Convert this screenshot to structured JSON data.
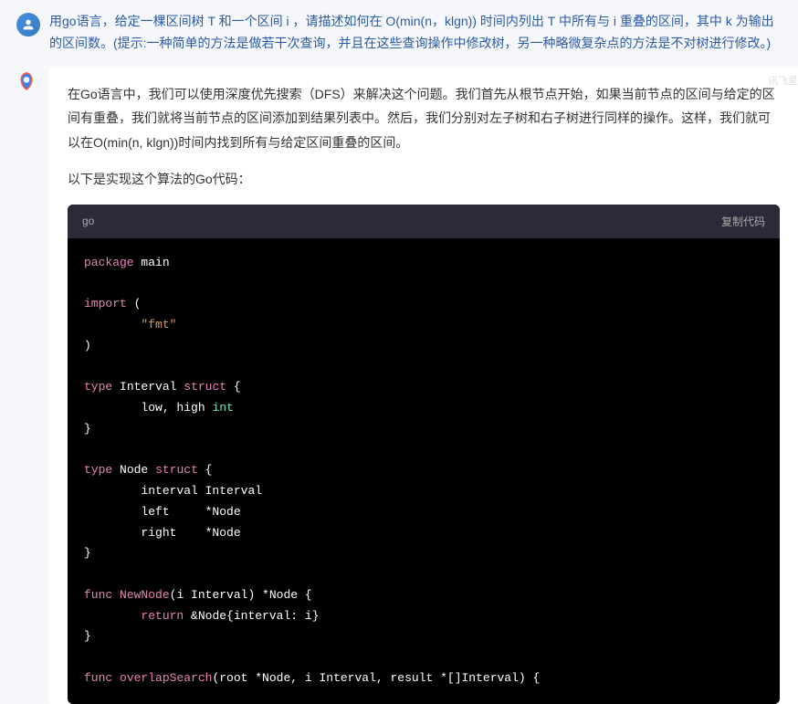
{
  "question": "用go语言，给定一棵区间树 T 和一个区间 i ，请描述如何在 O(min(n，klgn)) 时间内列出 T 中所有与 i 重叠的区间，其中 k 为输出的区间数。(提示:一种简单的方法是做若干次查询，并且在这些查询操作中修改树，另一种略微复杂点的方法是不对树进行修改。)",
  "watermark": "讯飞星",
  "answer_p1": "在Go语言中，我们可以使用深度优先搜索（DFS）来解决这个问题。我们首先从根节点开始，如果当前节点的区间与给定的区间有重叠，我们就将当前节点的区间添加到结果列表中。然后，我们分别对左子树和右子树进行同样的操作。这样，我们就可以在O(min(n, klgn))时间内找到所有与给定区间重叠的区间。",
  "answer_p2": "以下是实现这个算法的Go代码：",
  "code": {
    "lang": "go",
    "copy_label": "复制代码",
    "tokens": {
      "package": "package",
      "main": "main",
      "import": "import",
      "fmt": "\"fmt\"",
      "type": "type",
      "interval_name": "Interval",
      "struct": "struct",
      "low_high": "low, high",
      "int": "int",
      "node_name": "Node",
      "interval_field": "interval Interval",
      "left_field": "left     *Node",
      "right_field": "right    *Node",
      "func": "func",
      "newnode": "NewNode",
      "newnode_params": "(i Interval) *Node {",
      "return": "return",
      "newnode_body": "&Node{interval: i}",
      "overlap": "overlapSearch",
      "overlap_params": "(root *Node, i Interval, result *[]Interval) {"
    }
  }
}
